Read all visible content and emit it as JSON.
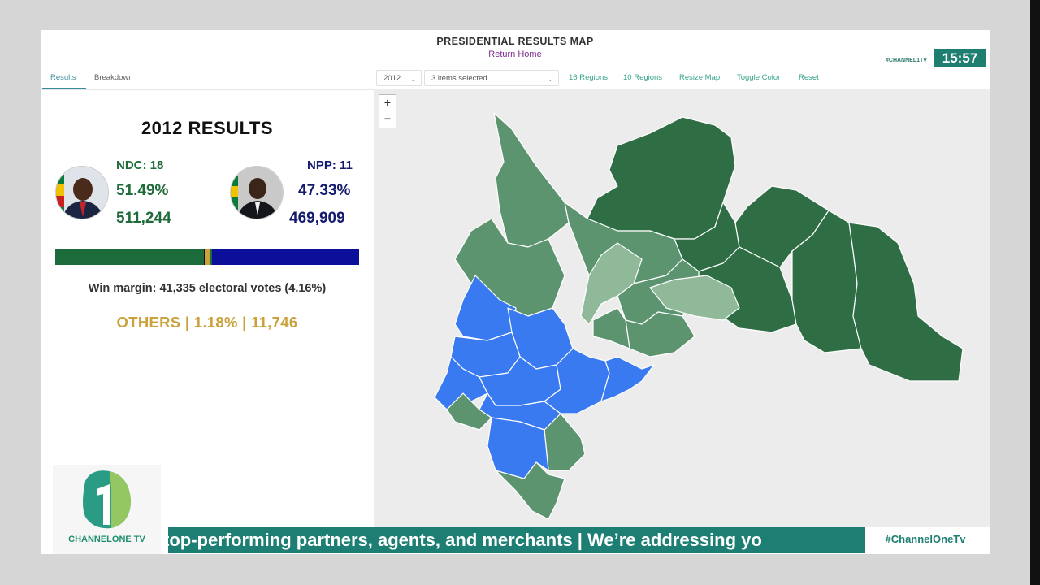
{
  "header": {
    "title": "PRESIDENTIAL RESULTS MAP",
    "return_home": "Return Home",
    "channel_tag": "#CHANNEL1TV",
    "time": "15:57"
  },
  "tabs": [
    {
      "label": "Results",
      "active": true
    },
    {
      "label": "Breakdown",
      "active": false
    }
  ],
  "toolbar": {
    "year_select": "2012",
    "items_select": "3 items selected",
    "links": [
      "16 Regions",
      "10 Regions",
      "Resize Map",
      "Toggle Color",
      "Reset"
    ]
  },
  "map_controls": {
    "zoom_in": "+",
    "zoom_out": "−"
  },
  "results": {
    "title": "2012 RESULTS",
    "ndc": {
      "label": "NDC: 18",
      "percent": "51.49%",
      "votes": "511,244",
      "color": "#1f6b3a"
    },
    "npp": {
      "label": "NPP: 11",
      "percent": "47.33%",
      "votes": "469,909",
      "color": "#141a6e"
    },
    "margin_bar": {
      "ndc_share": 0.5149,
      "npp_color": "#0b0f9a",
      "ndc_color": "#1c6b3a"
    },
    "win_margin": "Win margin: 41,335 electoral votes (4.16%)",
    "others": "OTHERS | 1.18% | 11,746",
    "others_color": "#c9a23b"
  },
  "map_colors": {
    "ndc_strong": "#2f6e45",
    "ndc_mid": "#5c9470",
    "ndc_light": "#90b99a",
    "npp": "#3a7af0"
  },
  "branding": {
    "logo_text": "CHANNELONE TV"
  },
  "ticker": {
    "text": "top-performing partners, agents, and merchants  |  We’re addressing yo",
    "hashtag": "#ChannelOneTv"
  }
}
